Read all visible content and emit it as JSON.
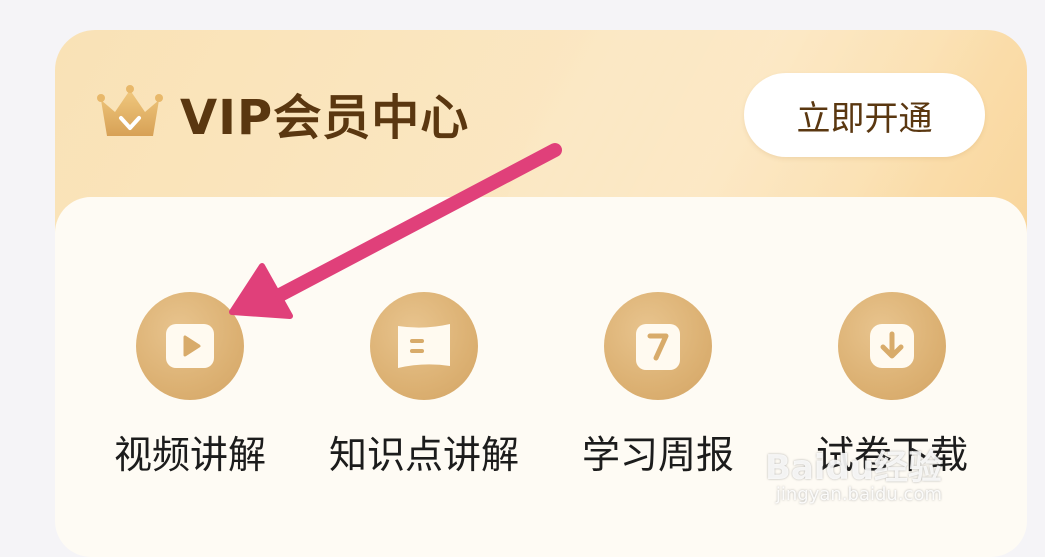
{
  "vip_card": {
    "title": "VIP会员中心",
    "open_button_label": "立即开通",
    "crown_icon": "crown-icon"
  },
  "features": [
    {
      "label": "视频讲解",
      "icon": "play-video-icon"
    },
    {
      "label": "知识点讲解",
      "icon": "card-lines-icon"
    },
    {
      "label": "学习周报",
      "icon": "calendar-seven-icon"
    },
    {
      "label": "试卷下载",
      "icon": "download-icon"
    }
  ],
  "annotation": {
    "arrow_color": "#e0407a"
  },
  "watermark": {
    "brand": "Baidu经验",
    "url": "jingyan.baidu.com"
  },
  "colors": {
    "card_gold_light": "#f9e2b6",
    "card_gold_dark": "#f6cc8a",
    "title_brown": "#5a3710",
    "icon_circle": "#dcb173"
  }
}
